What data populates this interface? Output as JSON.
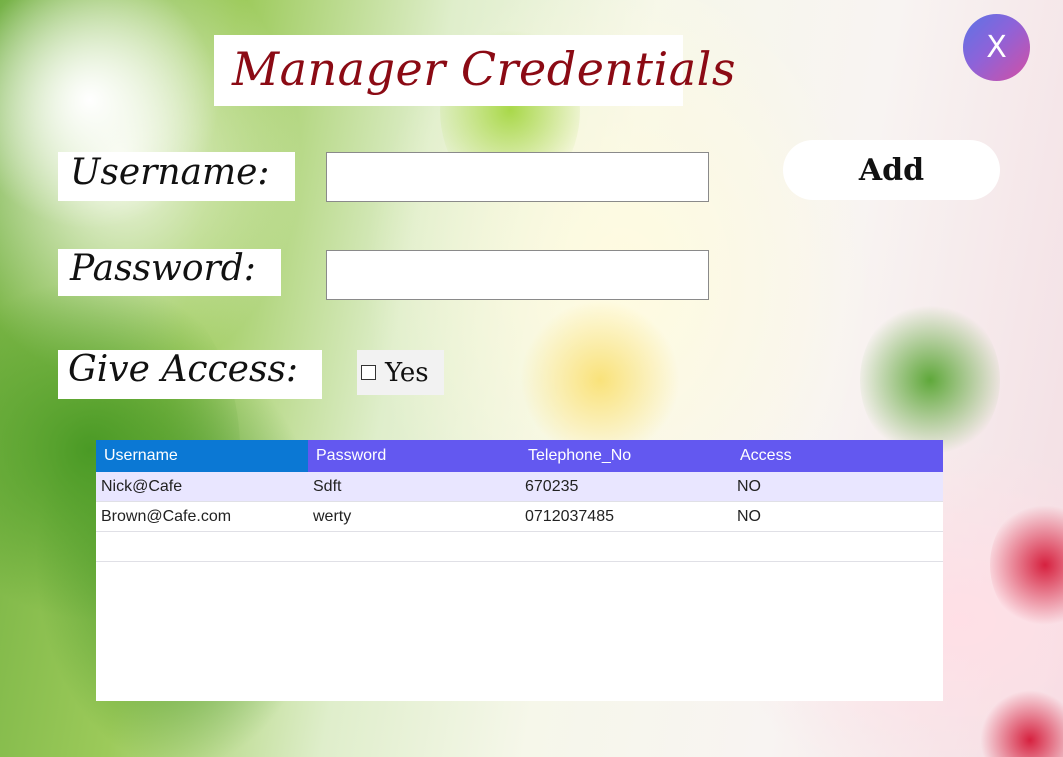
{
  "window": {
    "title": "Manager Credentials",
    "close_label": "X"
  },
  "form": {
    "username_label": "Username:",
    "username_value": "",
    "password_label": "Password:",
    "password_value": "",
    "access_label": "Give Access:",
    "access_checkbox_label": "Yes",
    "access_checked": false,
    "add_label": "Add"
  },
  "table": {
    "columns": [
      "Username",
      "Password",
      "Telephone_No",
      "Access"
    ],
    "rows": [
      [
        "Nick@Cafe",
        "Sdft",
        "670235",
        "NO"
      ],
      [
        "Brown@Cafe.com",
        "werty",
        "0712037485",
        "NO"
      ]
    ]
  },
  "colors": {
    "title": "#8b0a14",
    "header_first": "#0b78d4",
    "header": "#6358f0",
    "selected_row": "#e9e6ff"
  }
}
